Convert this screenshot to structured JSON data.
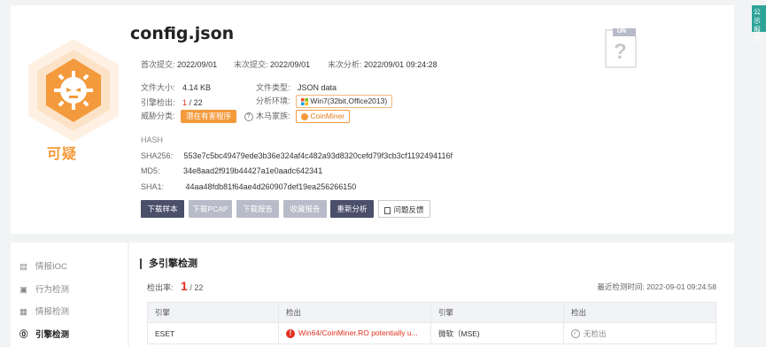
{
  "file": {
    "name": "config.json",
    "verdict": "可疑"
  },
  "times": {
    "first_submit_label": "首次提交:",
    "first_submit": "2022/09/01",
    "last_submit_label": "末次提交:",
    "last_submit": "2022/09/01",
    "last_analysis_label": "末次分析:",
    "last_analysis": "2022/09/01 09:24:28"
  },
  "info": {
    "size_label": "文件大小:",
    "size": "4.14 KB",
    "type_label": "文件类型:",
    "type": "JSON data",
    "engines_label": "引擎检出:",
    "engines_hit": "1",
    "engines_total": "/ 22",
    "env_label": "分析环境:",
    "env": "Win7(32bit,Office2013)",
    "threat_label": "威胁分类:",
    "threat": "潜在有害程序",
    "family_label": "木马家族:",
    "family": "CoinMiner"
  },
  "hash": {
    "heading": "HASH",
    "sha256_label": "SHA256:",
    "sha256": "553e7c5bc49479ede3b36e324af4c482a93d8320cefd79f3cb3cf1192494116f",
    "md5_label": "MD5:",
    "md5": "34e8aad2f919b44427a1e0aadc642341",
    "sha1_label": "SHA1:",
    "sha1": "44aa48fdb81f64ae4d260907def19ea256266150"
  },
  "buttons": {
    "download_sample": "下载样本",
    "download_pcap": "下载PCAP",
    "download_report": "下载报告",
    "favorite_report": "收藏报告",
    "reanalyze": "重新分析",
    "feedback": "问题反馈"
  },
  "unknown_icon": {
    "badge": "UN",
    "glyph": "?"
  },
  "side_tab": {
    "line1": "公示",
    "line2": "报告"
  },
  "nav": {
    "items": [
      {
        "label": "情报IOC",
        "icon": "document-icon"
      },
      {
        "label": "行为检测",
        "icon": "image-icon"
      },
      {
        "label": "情报检测",
        "icon": "grid-icon"
      },
      {
        "label": "引擎检测",
        "icon": "question-icon"
      }
    ]
  },
  "engine_section": {
    "title": "多引擎检测",
    "rate_label": "检出率:",
    "rate_hit": "1",
    "rate_total": "/ 22",
    "last_time_label": "最近检测时间:",
    "last_time": "2022-09-01 09:24:58",
    "columns": [
      "引擎",
      "检出",
      "引擎",
      "检出"
    ],
    "rows": [
      [
        "ESET",
        "Win64/CoinMiner.RO potentially u...",
        "微软（MSE)",
        "无检出"
      ]
    ]
  },
  "colors": {
    "accent_orange": "#f39a3c",
    "danger_red": "#e0301e",
    "button_dark": "#4a4f6a",
    "button_disabled": "#b8bbc8"
  }
}
